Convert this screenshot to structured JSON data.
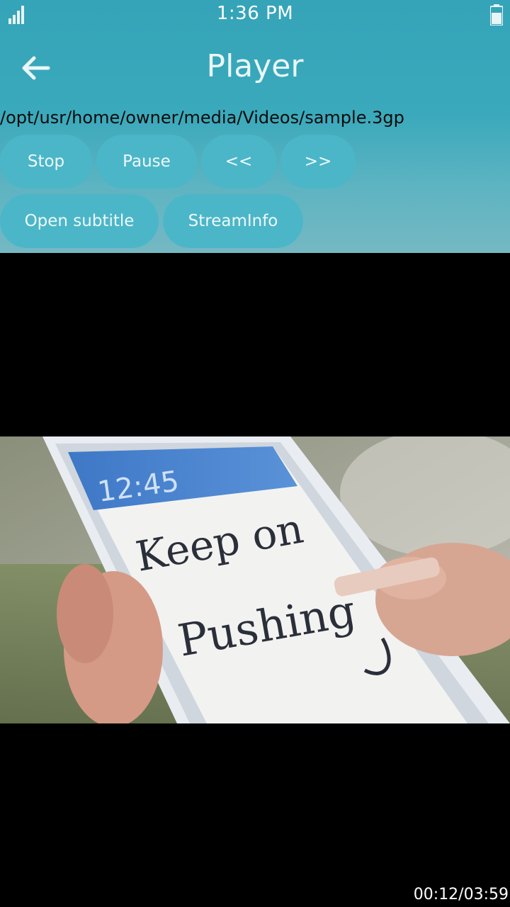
{
  "status_bar": {
    "time": "1:36 PM",
    "signal_icon": "signal-bars-icon",
    "battery_icon": "battery-icon"
  },
  "header": {
    "title": "Player",
    "back_icon": "arrow-left-icon"
  },
  "file_path": "/opt/usr/home/owner/media/Videos/sample.3gp",
  "controls": {
    "stop_label": "Stop",
    "pause_label": "Pause",
    "rewind_label": "<<",
    "forward_label": ">>",
    "open_subtitle_label": "Open subtitle",
    "stream_info_label": "StreamInfo"
  },
  "video": {
    "screen_clock": "12:45",
    "handwriting_line1": "Keep on",
    "handwriting_line2": "Pushing"
  },
  "playback": {
    "timecode": "00:12/03:59"
  },
  "colors": {
    "panel_top": "#35a4b8",
    "panel_bottom": "#75b8c3",
    "button_fill": "#4bb6c8",
    "background": "#000000"
  }
}
